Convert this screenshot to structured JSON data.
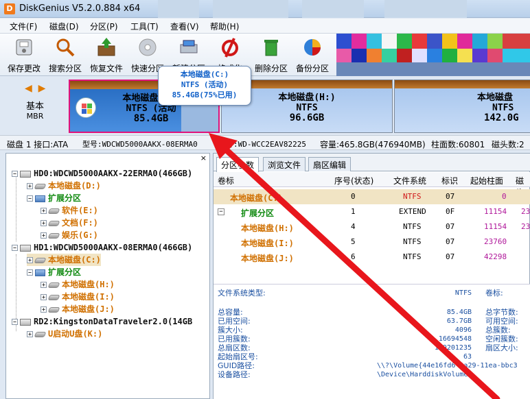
{
  "window": {
    "title": "DiskGenius V5.2.0.884 x64",
    "app_icon_letter": "D"
  },
  "menu": [
    "文件(F)",
    "磁盘(D)",
    "分区(P)",
    "工具(T)",
    "查看(V)",
    "帮助(H)"
  ],
  "toolbar": {
    "save": "保存更改",
    "search": "搜索分区",
    "recover": "恢复文件",
    "quick": "快速分区",
    "new": "新建分区",
    "format": "格式化",
    "delete": "删除分区",
    "backup": "备份分区"
  },
  "diskmap": {
    "nav": "◀ ▶",
    "disk_type": "基本",
    "disk_type2": "MBR",
    "partitions": [
      {
        "name": "本地磁盘(C:)",
        "fs": "NTFS (活动",
        "size": "85.4GB"
      },
      {
        "name": "本地磁盘(H:)",
        "fs": "NTFS",
        "size": "96.6GB"
      },
      {
        "name": "本地磁盘",
        "fs": "NTFS",
        "size": "142.0G"
      }
    ],
    "tooltip": {
      "line1": "本地磁盘(C:)",
      "line2": "NTFS (活动)",
      "line3": "85.4GB(75%已用)"
    }
  },
  "diskinfo": {
    "disk": "磁盘 1 接口:ATA",
    "model": "型号:WDCWD5000AAKX-08ERMA0",
    "serial": "列号:WD-WCC2EAV82225",
    "capacity": "容量:465.8GB(476940MB)",
    "cylinders": "柱面数:60801",
    "heads": "磁头数:2"
  },
  "tree": {
    "close": "×",
    "items": [
      {
        "label": "HD0:WDCWD5000AAKX-22ERMA0(466GB)"
      },
      {
        "label": "本地磁盘(D:)"
      },
      {
        "label": "扩展分区"
      },
      {
        "label": "软件(E:)"
      },
      {
        "label": "文档(F:)"
      },
      {
        "label": "娱乐(G:)"
      },
      {
        "label": "HD1:WDCWD5000AAKX-08ERMA0(466GB)"
      },
      {
        "label": "本地磁盘(C:)"
      },
      {
        "label": "扩展分区"
      },
      {
        "label": "本地磁盘(H:)"
      },
      {
        "label": "本地磁盘(I:)"
      },
      {
        "label": "本地磁盘(J:)"
      },
      {
        "label": "RD2:KingstonDataTraveler2.0(14GB"
      },
      {
        "label": "U启动U盘(K:)"
      }
    ]
  },
  "tabs": [
    "分区参数",
    "浏览文件",
    "扇区编辑"
  ],
  "grid": {
    "headers": [
      "卷标",
      "序号(状态)",
      "文件系统",
      "标识",
      "起始柱面",
      "磁头"
    ],
    "rows": [
      {
        "name": "本地磁盘(C:)",
        "seq": "0",
        "fs": "NTFS",
        "id": "07",
        "start": "0",
        "head": ""
      },
      {
        "name": "扩展分区",
        "seq": "1",
        "fs": "EXTEND",
        "id": "0F",
        "start": "11154",
        "head": "23"
      },
      {
        "name": "本地磁盘(H:)",
        "seq": "4",
        "fs": "NTFS",
        "id": "07",
        "start": "11154",
        "head": "23"
      },
      {
        "name": "本地磁盘(I:)",
        "seq": "5",
        "fs": "NTFS",
        "id": "07",
        "start": "23760",
        "head": ""
      },
      {
        "name": "本地磁盘(J:)",
        "seq": "6",
        "fs": "NTFS",
        "id": "07",
        "start": "42298",
        "head": ""
      }
    ]
  },
  "fsinfo": {
    "type_label": "文件系统类型:",
    "type_value": "NTFS",
    "vol_label": "卷标:",
    "rows": [
      {
        "label": "总容量:",
        "value": "85.4GB",
        "right": "总字节数:"
      },
      {
        "label": "已用空间:",
        "value": "63.7GB",
        "right": "可用空间:"
      },
      {
        "label": "簇大小:",
        "value": "4096",
        "right": "总簇数:"
      },
      {
        "label": "已用簇数:",
        "value": "16694548",
        "right": "空闲簇数:"
      },
      {
        "label": "总扇区数:",
        "value": "179201235",
        "right": "扇区大小:"
      },
      {
        "label": "起始扇区号:",
        "value": "63",
        "right": ""
      },
      {
        "label": "GUID路径:",
        "value": "\\\\?\\Volume{44e16fd6-2a29-11ea-bbc3",
        "right": ""
      },
      {
        "label": "设备路径:",
        "value": "\\Device\\HarddiskVolume5",
        "right": ""
      }
    ]
  }
}
